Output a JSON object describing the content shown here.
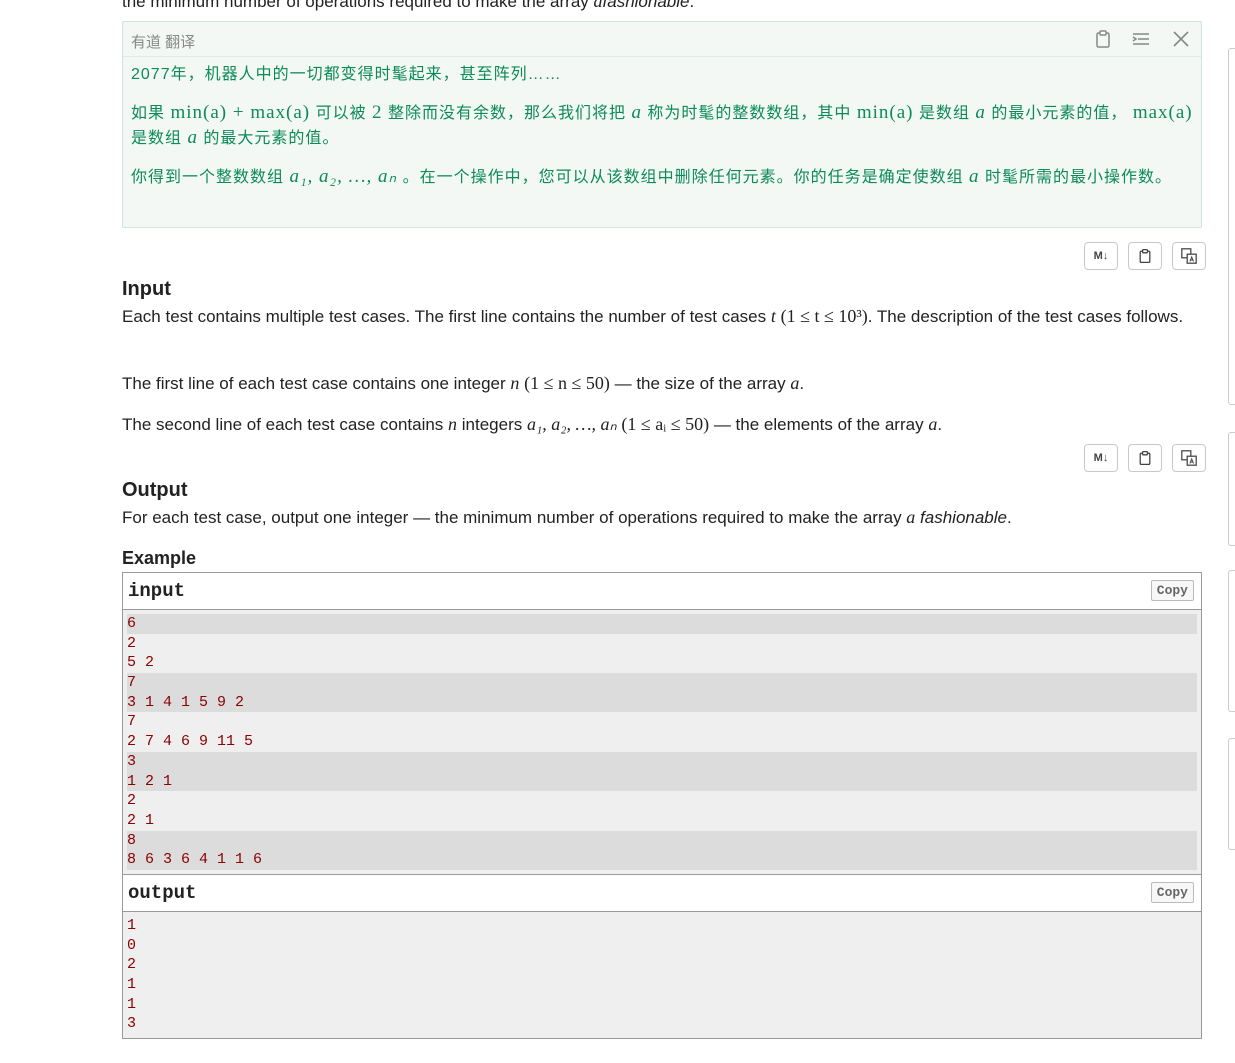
{
  "top_cut": {
    "pre": "the minimum number of operations required to make the array ",
    "var": "a",
    "emph": "fashionable",
    "post": "."
  },
  "youdao": {
    "title": "有道 翻译",
    "p1": "2077年，机器人中的一切都变得时髦起来，甚至阵列……",
    "p2_a": "如果 ",
    "p2_m1": "min(a) + max(a)",
    "p2_b": " 可以被 ",
    "p2_m2": "2",
    "p2_c": " 整除而没有余数，那么我们将把 ",
    "p2_m3": "a",
    "p2_d": " 称为时髦的整数数组，其中 ",
    "p2_m4": "min(a)",
    "p2_e": " 是数组 ",
    "p2_m5": "a",
    "p2_f": " 的最小元素的值， ",
    "p2_m6": "max(a)",
    "p2_g": " 是数组 ",
    "p2_m7": "a",
    "p2_h": " 的最大元素的值。",
    "p3_a": "你得到一个整数数组 ",
    "p3_m1": "a₁, a₂, …, aₙ",
    "p3_b": " 。在一个操作中，您可以从该数组中删除任何元素。你的任务是确定使数组 ",
    "p3_m2": "a",
    "p3_c": " 时髦所需的最小操作数。"
  },
  "toolbar": {
    "md_label": "M↓"
  },
  "input_section": {
    "title": "Input",
    "p1_a": "Each test contains multiple test cases. The first line contains the number of test cases ",
    "p1_m1": "t",
    "p1_m2": "(1 ≤ t ≤ 10³)",
    "p1_b": ". The description of the test cases follows.",
    "p2_a": "The first line of each test case contains one integer ",
    "p2_m1": "n",
    "p2_m2": "(1 ≤ n ≤ 50)",
    "p2_b": " — the size of the array ",
    "p2_m3": "a",
    "p2_c": ".",
    "p3_a": "The second line of each test case contains ",
    "p3_m1": "n",
    "p3_b": " integers ",
    "p3_m2": "a₁, a₂, …, aₙ",
    "p3_m3": "(1 ≤ aᵢ ≤ 50)",
    "p3_c": " — the elements of the array ",
    "p3_m4": "a",
    "p3_d": "."
  },
  "output_section": {
    "title": "Output",
    "p1_a": "For each test case, output one integer — the minimum number of operations required to make the array ",
    "p1_m1": "a",
    "p1_emph": "fashionable",
    "p1_b": "."
  },
  "example": {
    "title": "Example",
    "input_label": "input",
    "output_label": "output",
    "copy_label": "Copy",
    "input_lines": [
      "6",
      "2",
      "5 2",
      "7",
      "3 1 4 1 5 9 2",
      "7",
      "2 7 4 6 9 11 5",
      "3",
      "1 2 1",
      "2",
      "2 1",
      "8",
      "8 6 3 6 4 1 1 6"
    ],
    "output_lines": [
      "1",
      "0",
      "2",
      "1",
      "1",
      "3"
    ]
  }
}
